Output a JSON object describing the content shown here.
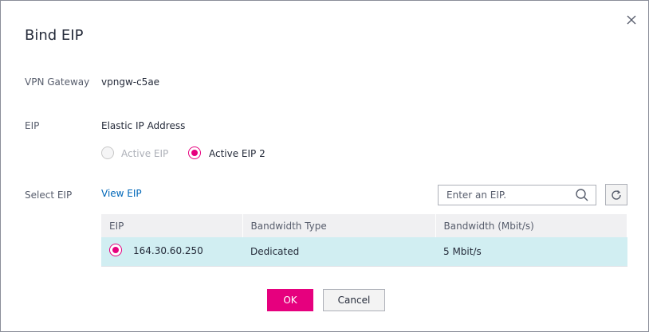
{
  "dialog": {
    "title": "Bind EIP"
  },
  "form": {
    "vpn_gateway_label": "VPN Gateway",
    "vpn_gateway_value": "vpngw-c5ae",
    "eip_label": "EIP",
    "eip_value": "Elastic IP Address",
    "eip_options": [
      {
        "label": "Active EIP",
        "state": "disabled"
      },
      {
        "label": "Active EIP 2",
        "state": "selected"
      }
    ],
    "select_eip_label": "Select EIP",
    "view_eip_link": "View EIP"
  },
  "search": {
    "placeholder": "Enter an EIP."
  },
  "table": {
    "columns": [
      "EIP",
      "Bandwidth Type",
      "Bandwidth (Mbit/s)"
    ],
    "rows": [
      {
        "eip": "164.30.60.250",
        "bandwidth_type": "Dedicated",
        "bandwidth": "5 Mbit/s",
        "selected": true
      }
    ]
  },
  "buttons": {
    "ok": "OK",
    "cancel": "Cancel"
  },
  "colors": {
    "accent": "#e6007e",
    "link": "#0067b8",
    "selected_row": "#d1eef2"
  },
  "icons": [
    "close-icon",
    "search-icon",
    "refresh-icon"
  ]
}
